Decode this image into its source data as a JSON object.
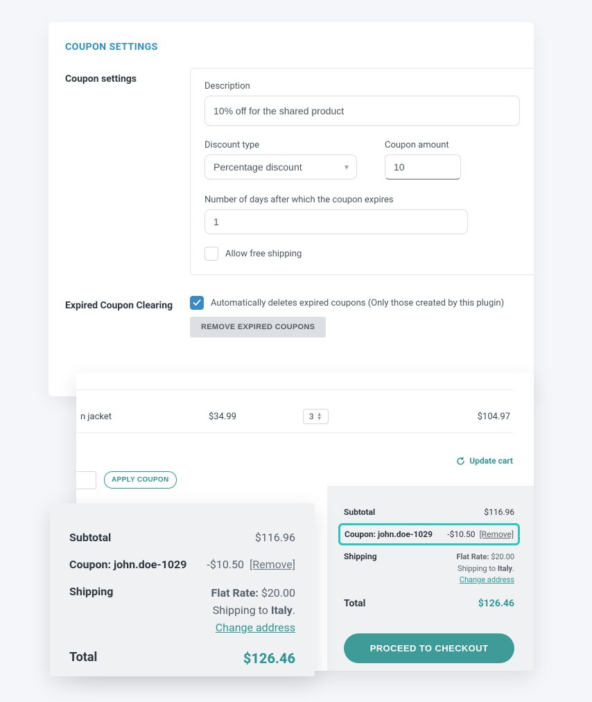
{
  "settings": {
    "title": "COUPON SETTINGS",
    "section_label": "Coupon settings",
    "description_label": "Description",
    "description_value": "10% off for the shared product",
    "discount_type_label": "Discount type",
    "discount_type_value": "Percentage discount",
    "coupon_amount_label": "Coupon amount",
    "coupon_amount_value": "10",
    "expire_label": "Number of days after which the coupon expires",
    "expire_value": "1",
    "allow_free_shipping_label": "Allow free shipping",
    "allow_free_shipping_checked": false,
    "expired_section_label": "Expired Coupon Clearing",
    "auto_delete_label": "Automatically deletes expired coupons (Only those created by this plugin)",
    "auto_delete_checked": true,
    "remove_expired_button": "REMOVE EXPIRED COUPONS"
  },
  "cart": {
    "item_name": "n jacket",
    "item_price": "$34.99",
    "item_qty": "3",
    "item_total": "$104.97",
    "update_cart": "Update cart",
    "apply_coupon": "APPLY COUPON",
    "subtotal_label": "Subtotal",
    "subtotal_value": "$116.96",
    "coupon_label": "Coupon: john.doe-1029",
    "coupon_value": "-$10.50",
    "remove_text": "[Remove]",
    "shipping_label": "Shipping",
    "flat_rate_label": "Flat Rate:",
    "flat_rate_value": "$20.00",
    "shipping_to_prefix": "Shipping to ",
    "shipping_to_country": "Italy",
    "change_address": "Change address",
    "total_label": "Total",
    "total_value": "$126.46",
    "checkout_button": "PROCEED TO CHECKOUT"
  }
}
